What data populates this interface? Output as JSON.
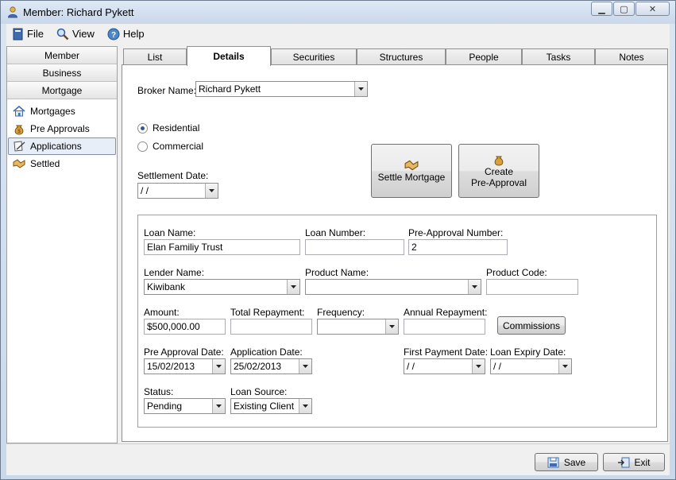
{
  "window": {
    "title": "Member: Richard Pykett"
  },
  "menu": {
    "file": "File",
    "view": "View",
    "help": "Help"
  },
  "leftnav": {
    "headers": [
      "Member",
      "Business",
      "Mortgage"
    ],
    "items": [
      {
        "label": "Mortgages",
        "icon": "house-icon"
      },
      {
        "label": "Pre Approvals",
        "icon": "money-bag-icon"
      },
      {
        "label": "Applications",
        "icon": "document-pen-icon"
      },
      {
        "label": "Settled",
        "icon": "handshake-icon"
      }
    ],
    "selected": "Applications"
  },
  "tabs": [
    "List",
    "Details",
    "Securities",
    "Structures",
    "People",
    "Tasks",
    "Notes"
  ],
  "active_tab": "Details",
  "details": {
    "broker_label": "Broker Name:",
    "broker_value": "Richard Pykett",
    "residential_label": "Residential",
    "commercial_label": "Commercial",
    "residential_selected": true,
    "settlement_label": "Settlement Date:",
    "settlement_value": "  /   /",
    "settle_btn": "Settle Mortgage",
    "create_btn_line1": "Create",
    "create_btn_line2": "Pre-Approval",
    "loan_name_label": "Loan Name:",
    "loan_name_value": "Elan Familiy Trust",
    "loan_number_label": "Loan Number:",
    "loan_number_value": "",
    "preapproval_number_label": "Pre-Approval Number:",
    "preapproval_number_value": "2",
    "lender_label": "Lender Name:",
    "lender_value": "Kiwibank",
    "product_name_label": "Product Name:",
    "product_name_value": "",
    "product_code_label": "Product Code:",
    "product_code_value": "",
    "amount_label": "Amount:",
    "amount_value": "$500,000.00",
    "total_repayment_label": "Total Repayment:",
    "total_repayment_value": "",
    "frequency_label": "Frequency:",
    "frequency_value": "",
    "annual_repayment_label": "Annual Repayment:",
    "annual_repayment_value": "",
    "commissions_btn": "Commissions",
    "preapproval_date_label": "Pre Approval Date:",
    "preapproval_date_value": "15/02/2013",
    "application_date_label": "Application Date:",
    "application_date_value": "25/02/2013",
    "first_payment_label": "First Payment Date:",
    "first_payment_value": "  /   /",
    "loan_expiry_label": "Loan Expiry Date:",
    "loan_expiry_value": "  /   /",
    "status_label": "Status:",
    "status_value": "Pending",
    "loan_source_label": "Loan Source:",
    "loan_source_value": "Existing Client"
  },
  "footer": {
    "save": "Save",
    "exit": "Exit"
  }
}
